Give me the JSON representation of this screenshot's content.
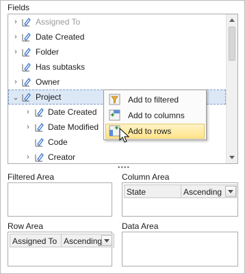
{
  "fields": {
    "label": "Fields",
    "items": [
      {
        "label": "Assigned To",
        "expander": "collapsed",
        "dim": true
      },
      {
        "label": "Date Created",
        "expander": "collapsed"
      },
      {
        "label": "Folder",
        "expander": "collapsed"
      },
      {
        "label": "Has subtasks",
        "expander": "none"
      },
      {
        "label": "Owner",
        "expander": "collapsed"
      },
      {
        "label": "Project",
        "expander": "expanded",
        "selected": true
      },
      {
        "label": "Date Created",
        "expander": "collapsed",
        "child": true
      },
      {
        "label": "Date Modified",
        "expander": "collapsed",
        "child": true
      },
      {
        "label": "Code",
        "expander": "none",
        "child": true
      },
      {
        "label": "Creator",
        "expander": "collapsed",
        "child": true
      }
    ]
  },
  "context_menu": {
    "items": [
      {
        "label": "Add to filtered",
        "icon": "filter-area-icon"
      },
      {
        "label": "Add to columns",
        "icon": "column-area-icon"
      },
      {
        "label": "Add to rows",
        "icon": "row-area-icon",
        "hot": true
      }
    ]
  },
  "areas": {
    "filtered": {
      "label": "Filtered Area"
    },
    "column": {
      "label": "Column Area",
      "chip": {
        "name": "State",
        "sort": "Ascending"
      }
    },
    "row": {
      "label": "Row Area",
      "chip": {
        "name": "Assigned To",
        "sort": "Ascending"
      }
    },
    "data": {
      "label": "Data Area"
    }
  },
  "colors": {
    "selection": "#dce8f6",
    "menu_hot": "#ffe48a",
    "field_icon_blue": "#2a6ac8"
  }
}
